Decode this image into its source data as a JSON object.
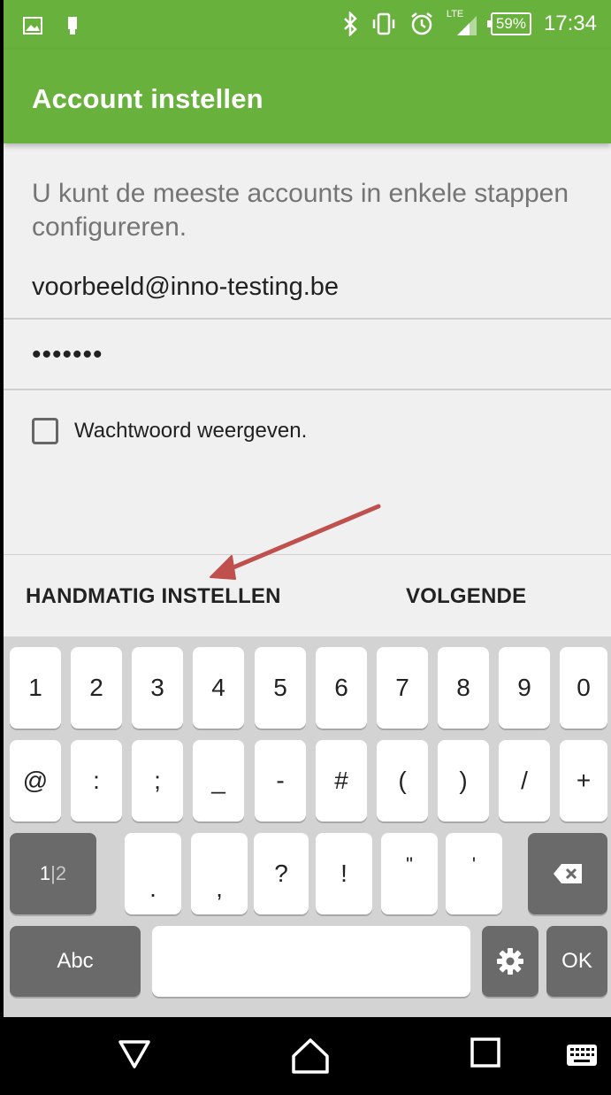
{
  "status_bar": {
    "battery": "59%",
    "time": "17:34",
    "network": "LTE"
  },
  "app_bar": {
    "title": "Account instellen"
  },
  "form": {
    "intro": "U kunt de meeste accounts in enkele stappen configureren.",
    "email_value": "voorbeeld@inno-testing.be",
    "password_value": "•••••••",
    "show_password_label": "Wachtwoord weergeven.",
    "show_password_checked": false
  },
  "actions": {
    "manual_setup": "HANDMATIG INSTELLEN",
    "next": "VOLGENDE"
  },
  "keyboard": {
    "row1": [
      "1",
      "2",
      "3",
      "4",
      "5",
      "6",
      "7",
      "8",
      "9",
      "0"
    ],
    "row2": [
      "@",
      ":",
      ";",
      "_",
      "-",
      "#",
      "(",
      ")",
      "/",
      "+"
    ],
    "row3": [
      ".",
      ",",
      "?",
      "!",
      "\"",
      "'"
    ],
    "mode_key_active": "1",
    "mode_key_sep": "|",
    "mode_key_inactive": "2",
    "abc_key": "Abc",
    "ok_key": "OK"
  },
  "colors": {
    "accent": "#69b13d",
    "annotation_arrow": "#c0504d"
  },
  "icons": {
    "status_left": [
      "image-icon",
      "sim-icon"
    ],
    "status_right": [
      "bluetooth-icon",
      "vibrate-icon",
      "alarm-icon",
      "signal-icon",
      "battery-icon"
    ],
    "keyboard": [
      "backspace-icon",
      "settings-gear-icon"
    ],
    "nav": [
      "back-triangle-icon",
      "home-icon",
      "recents-square-icon",
      "keyboard-switch-icon"
    ]
  }
}
